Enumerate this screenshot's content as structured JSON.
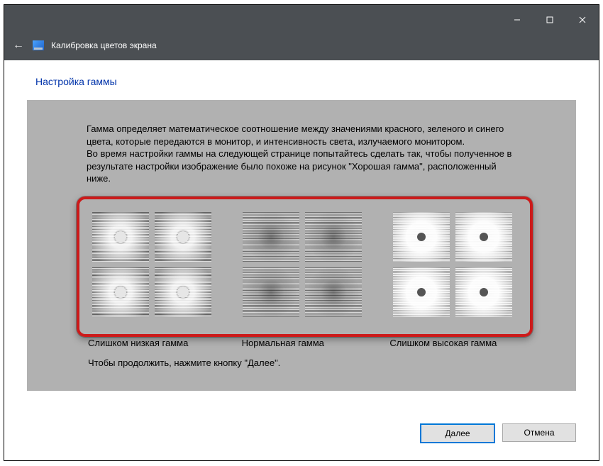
{
  "window": {
    "title": "Калибровка цветов экрана"
  },
  "wizard": {
    "heading": "Настройка гаммы",
    "paragraph1": "Гамма определяет математическое соотношение между значениями красного, зеленого и синего цвета, которые передаются в монитор, и интенсивность света, излучаемого монитором.",
    "paragraph2": "Во время настройки гаммы на следующей странице попытайтесь сделать так, чтобы полученное в результате настройки изображение было похоже на рисунок \"Хорошая гамма\", расположенный ниже.",
    "samples": {
      "low": "Слишком низкая гамма",
      "normal": "Нормальная гамма",
      "high": "Слишком высокая гамма"
    },
    "continue_line": "Чтобы продолжить, нажмите кнопку \"Далее\"."
  },
  "buttons": {
    "next": "Далее",
    "cancel": "Отмена"
  }
}
